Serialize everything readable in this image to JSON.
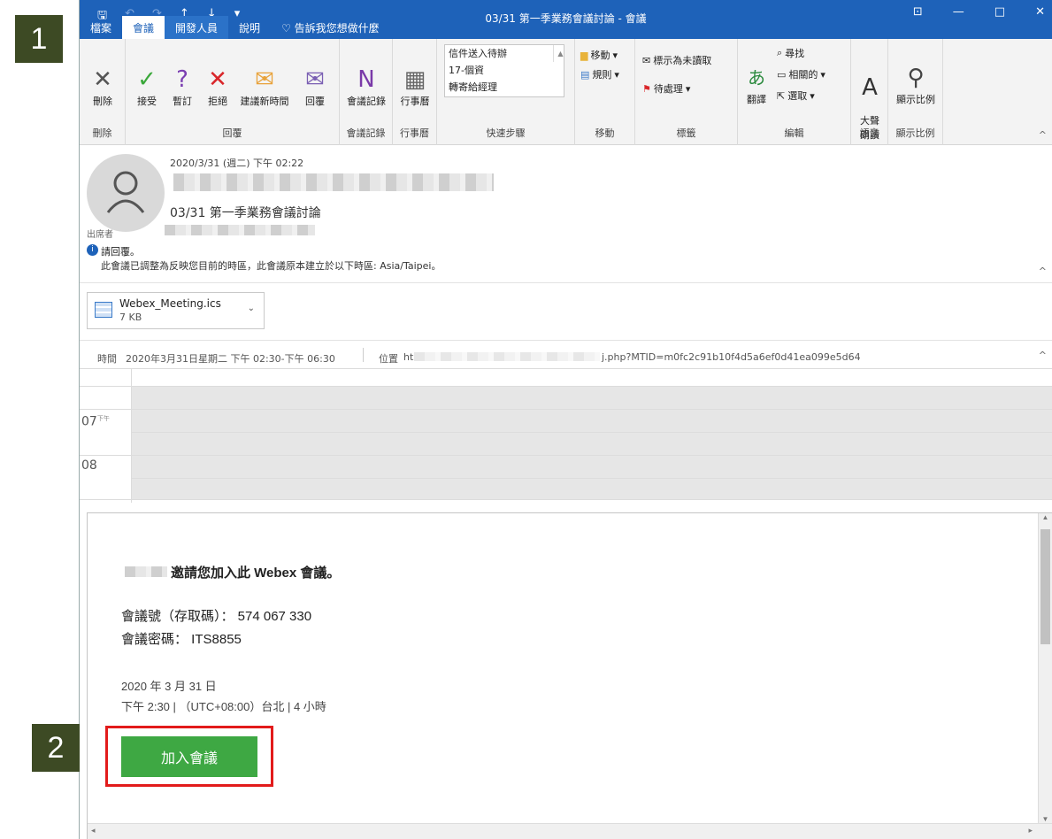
{
  "steps": {
    "one": "1",
    "two": "2"
  },
  "window": {
    "title": "03/31 第一季業務會議討論 - 會議",
    "qat": {
      "save": "🖫",
      "undo": "↶",
      "redo": "↷",
      "up": "↑",
      "down": "↓",
      "more": "▾"
    },
    "controls": {
      "ribbon": "⊡",
      "min": "—",
      "max": "□",
      "close": "✕"
    }
  },
  "menu": {
    "file": "檔案",
    "meeting": "會議",
    "developer": "開發人員",
    "help": "說明",
    "tellme": "告訴我您想做什麼"
  },
  "ribbon": {
    "delete": {
      "label": "刪除",
      "group": "刪除"
    },
    "accept": "接受",
    "tentative": "暫訂",
    "decline": "拒絕",
    "propose": "建議新時間",
    "reply": "回覆",
    "respond_group": "回覆",
    "notes": "會議記錄",
    "notes_group": "會議記錄",
    "calendar": "行事曆",
    "calendar_group": "行事曆",
    "quick_steps": {
      "items": [
        "信件送入待辦",
        "17-個資",
        "轉寄給經理"
      ],
      "group": "快速步驟"
    },
    "move": {
      "move": "移動",
      "rules": "規則",
      "group": "移動"
    },
    "tags": {
      "unread": "標示為未讀取",
      "followup": "待處理",
      "group": "標籤"
    },
    "edit": {
      "translate": "翻譯",
      "find": "尋找",
      "related": "相關的",
      "select": "選取",
      "group": "編輯"
    },
    "speech": {
      "read": "大聲\n朗讀",
      "group": "語音"
    },
    "zoom": {
      "label": "顯示比例",
      "group": "顯示比例"
    }
  },
  "header": {
    "datetime": "2020/3/31 (週二) 下午 02:22",
    "subject": "03/31 第一季業務會議討論",
    "attendees_label": "出席者",
    "notice_title": "請回覆。",
    "notice_text": "此會議已調整為反映您目前的時區，此會議原本建立於以下時區: Asia/Taipei。"
  },
  "attachment": {
    "name": "Webex_Meeting.ics",
    "size": "7 KB"
  },
  "calendar": {
    "time_label": "時間",
    "time_value": "2020年3月31日星期二 下午 02:30-下午 06:30",
    "location_label": "位置",
    "location_prefix": "ht",
    "location_suffix": "j.php?MTID=m0fc2c91b10f4d5a6ef0d41ea099e5d64",
    "hour1": "07",
    "hour1_suffix": "下午",
    "hour2": "08"
  },
  "body": {
    "invite": "邀請您加入此 Webex 會議。",
    "meeting_number": "會議號（存取碼）： 574 067 330",
    "password": "會議密碼： ITS8855",
    "date": "2020 年 3 月 31 日",
    "time": "下午 2:30 | （UTC+08:00）台北 | 4 小時",
    "join": "加入會議"
  },
  "colors": {
    "brand": "#1e62b9",
    "join": "#3ea843",
    "badge": "#3d4a24",
    "highlight": "#e21b1b"
  }
}
